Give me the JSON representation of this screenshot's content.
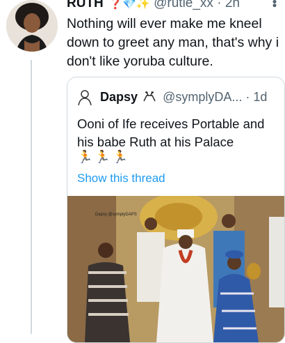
{
  "author": {
    "name": "RUTH",
    "emojis": "❓💎✨",
    "handle": "@rutie_xx",
    "time": "2h"
  },
  "tweet": {
    "text": "Nothing will ever make me kneel down to greet any man, that's why i don't like yoruba culture."
  },
  "quoted": {
    "name": "Dapsy",
    "handle": "@symplyDA...",
    "time": "1d",
    "text": "Ooni of Ife receives Portable and his babe Ruth at his Palace",
    "emojis": "🏃🏃🏃",
    "show_thread": "Show this thread",
    "watermark": "Dapsy @symplyDAPS"
  },
  "icons": {
    "more": "more-vertical-icon",
    "dapsy_logo": "deer-logo-icon",
    "verified": "none"
  },
  "colors": {
    "link": "#1d9bf0",
    "secondary": "#536471",
    "border": "#cfd9de",
    "text": "#0f1419"
  }
}
